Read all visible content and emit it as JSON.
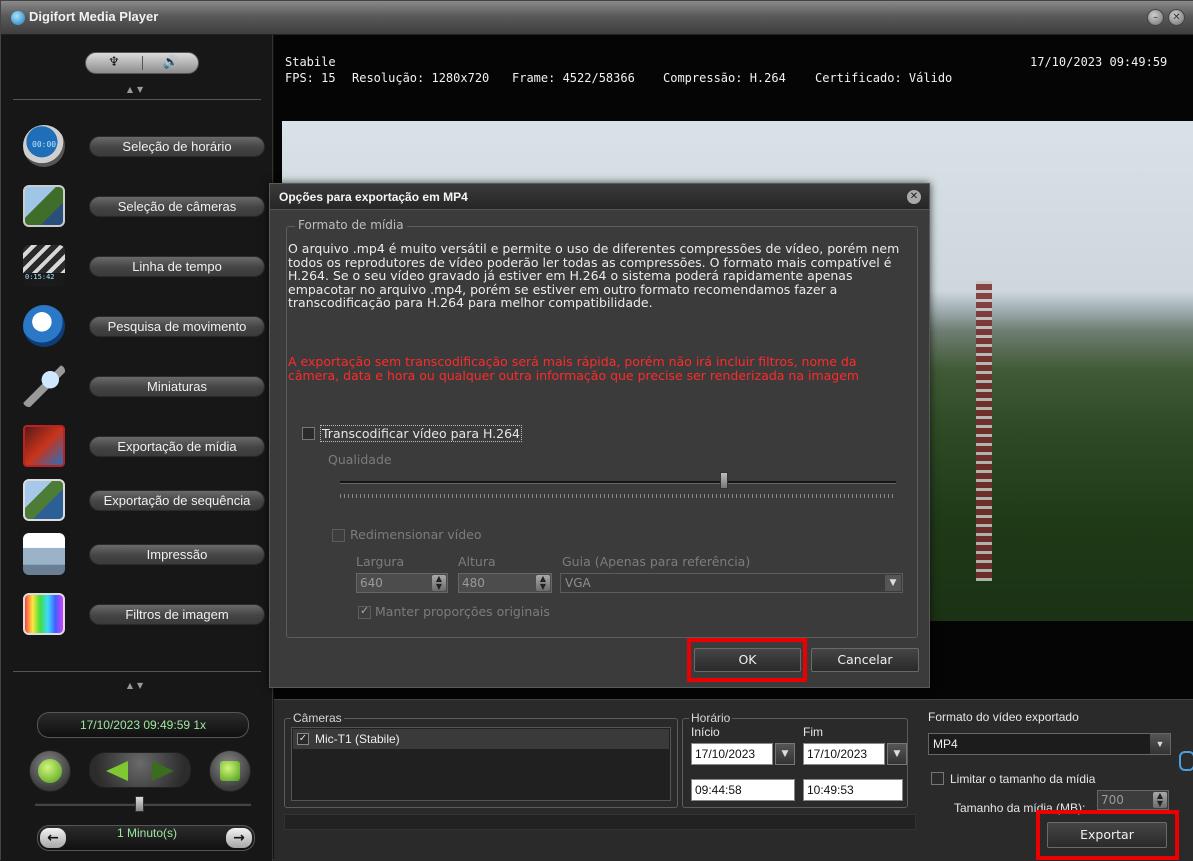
{
  "window": {
    "title": "Digifort Media Player"
  },
  "sidebar": {
    "items": [
      {
        "label": "Seleção de horário"
      },
      {
        "label": "Seleção de câmeras"
      },
      {
        "label": "Linha de tempo"
      },
      {
        "label": "Pesquisa de movimento"
      },
      {
        "label": "Miniaturas"
      },
      {
        "label": "Exportação de mídia"
      },
      {
        "label": "Exportação de sequência"
      },
      {
        "label": "Impressão"
      },
      {
        "label": "Filtros de imagem"
      }
    ],
    "icon_text": {
      "clock": "00:00",
      "timeline": "0:15:42"
    }
  },
  "playback": {
    "datetime": "17/10/2023 09:49:59 1x",
    "step": "1 Minuto(s)"
  },
  "video_info": {
    "camera": "Stabile",
    "fps": "FPS: 15",
    "resolution": "Resolução: 1280x720",
    "frame": "Frame: 4522/58366",
    "compression": "Compressão: H.264",
    "certificate": "Certificado: Válido",
    "timestamp": "17/10/2023 09:49:59"
  },
  "dialog": {
    "title": "Opções para exportação em MP4",
    "group_label": "Formato de mídia",
    "description": "O arquivo .mp4 é muito versátil e permite o uso de diferentes compressões de vídeo, porém nem todos os reprodutores de vídeo poderão ler todas as compressões. O formato mais compatível é H.264. Se o seu vídeo gravado já estiver em H.264 o sistema poderá rapidamente apenas empacotar no arquivo .mp4, porém se estiver em outro formato recomendamos fazer a transcodificação para H.264 para melhor compatibilidade.",
    "warning": "A exportação sem transcodificação será mais rápida, porém não irá incluir filtros, nome da câmera, data e hora ou qualquer outra informação que precise ser renderizada na imagem",
    "transcode_label": "Transcodificar vídeo para H.264",
    "transcode_checked": false,
    "quality_label": "Qualidade",
    "quality_value": 0.69,
    "resize_label": "Redimensionar vídeo",
    "width_label": "Largura",
    "width_value": "640",
    "height_label": "Altura",
    "height_value": "480",
    "guide_label": "Guia (Apenas para referência)",
    "guide_value": "VGA",
    "keep_ratio_label": "Manter proporções originais",
    "ok_label": "OK",
    "cancel_label": "Cancelar"
  },
  "export_panel": {
    "cameras_label": "Câmeras",
    "camera_item": "Mic-T1 (Stabile)",
    "time_label": "Horário",
    "start_label": "Início",
    "end_label": "Fim",
    "start_date": "17/10/2023",
    "end_date": "17/10/2023",
    "start_time": "09:44:58",
    "end_time": "10:49:53",
    "format_label": "Formato do vídeo exportado",
    "format_value": "MP4",
    "limit_label": "Limitar o tamanho da mídia",
    "size_label": "Tamanho da mídia (MB):",
    "size_value": "700",
    "export_button": "Exportar"
  },
  "colors": {
    "highlight": "#ea0000",
    "warning_text": "#ff2a2a",
    "status_green": "#9fe6a0"
  }
}
